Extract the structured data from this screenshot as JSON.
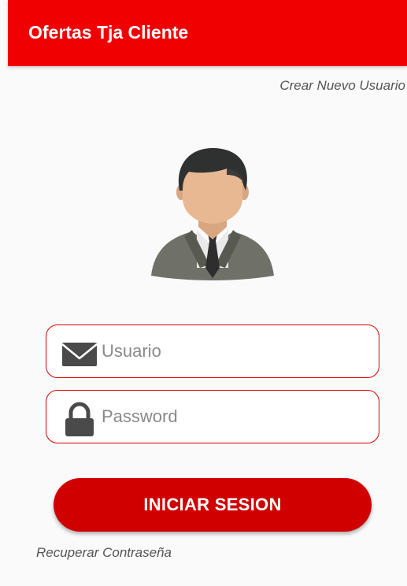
{
  "app_bar": {
    "title": "Ofertas Tja Cliente"
  },
  "links": {
    "create_user": "Crear Nuevo Usuario",
    "recover_password": "Recuperar Contraseña"
  },
  "form": {
    "username": {
      "value": "",
      "placeholder": "Usuario",
      "icon": "envelope-icon"
    },
    "password": {
      "value": "",
      "placeholder": "Password",
      "icon": "lock-icon"
    },
    "submit_label": "INICIAR SESION"
  },
  "avatar": {
    "icon": "user-avatar-icon"
  },
  "colors": {
    "app_bar": "#f00000",
    "primary_button": "#d00000",
    "field_border": "#d80000",
    "background": "#fafafa"
  }
}
